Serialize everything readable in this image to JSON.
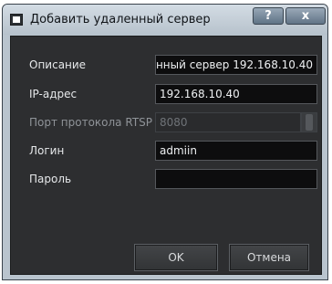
{
  "window": {
    "title": "Добавить удаленный сервер",
    "help_label": "?",
    "close_label": "x"
  },
  "form": {
    "description": {
      "label": "Описание",
      "value": "нный сервер 192.168.10.40"
    },
    "ip": {
      "label": "IP-адрес",
      "value": "192.168.10.40"
    },
    "rtsp_port": {
      "label": "Порт протокола RTSP",
      "value": "8080",
      "enabled": false
    },
    "login": {
      "label": "Логин",
      "value": "admiin"
    },
    "password": {
      "label": "Пароль",
      "value": ""
    }
  },
  "buttons": {
    "ok": "OK",
    "cancel": "Отмена"
  },
  "colors": {
    "frame": "#b9c4ce",
    "client_background": "#2d2e30",
    "input_background": "#0d0d0e"
  },
  "icons": {
    "window_icon": "window-icon",
    "help": "help-icon",
    "close": "close-icon"
  }
}
